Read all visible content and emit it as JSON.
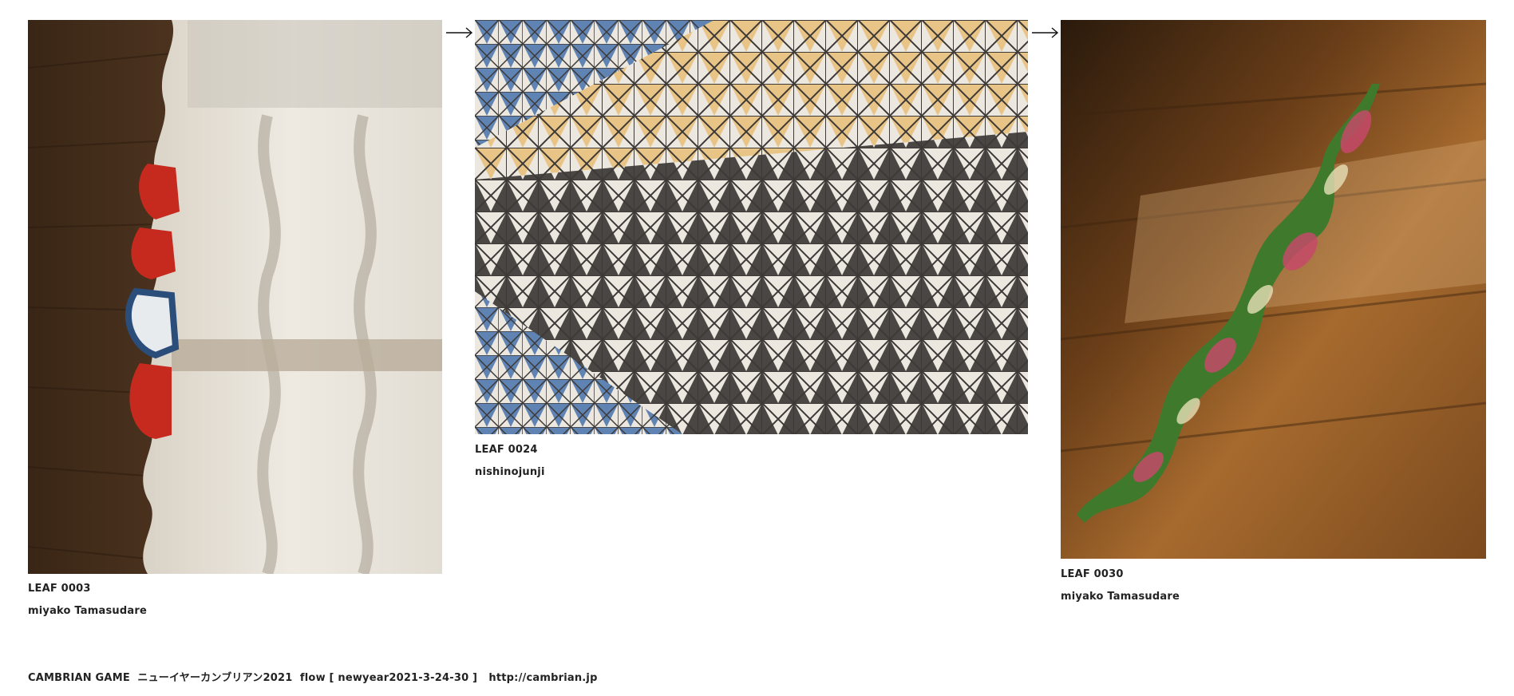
{
  "leaves": [
    {
      "id": "LEAF 0003",
      "author": "miyako Tamasudare",
      "image": "white curtains and gloves on wooden floor"
    },
    {
      "id": "LEAF 0024",
      "author": "nishinojunji",
      "image": "triangular tile wall pattern"
    },
    {
      "id": "LEAF 0030",
      "author": "miyako Tamasudare",
      "image": "twisted variegated leaf over wooden floor"
    }
  ],
  "footer": {
    "game": "CAMBRIAN GAME",
    "event": "ニューイヤーカンブリアン2021",
    "flow": "flow [ newyear2021-3-24-30 ]",
    "url": "http://cambrian.jp"
  },
  "icons": {
    "arrow": "right-arrow-icon"
  },
  "colors": {
    "text": "#222222",
    "background": "#ffffff"
  }
}
